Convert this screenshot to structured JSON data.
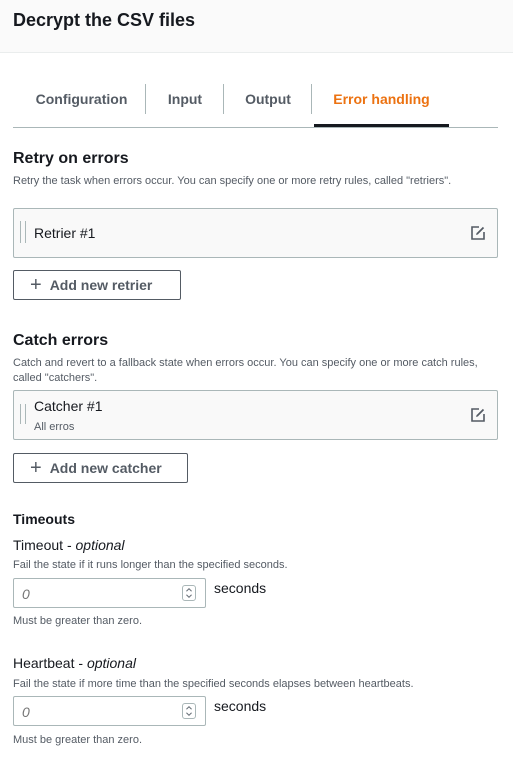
{
  "panel": {
    "title": "Decrypt the CSV files"
  },
  "tabs": [
    {
      "label": "Configuration",
      "active": false
    },
    {
      "label": "Input",
      "active": false
    },
    {
      "label": "Output",
      "active": false
    },
    {
      "label": "Error handling",
      "active": true
    }
  ],
  "retry": {
    "title": "Retry on errors",
    "description": "Retry the task when errors occur. You can specify one or more retry rules, called \"retriers\".",
    "items": [
      {
        "label": "Retrier #1"
      }
    ],
    "add_button": "Add new retrier"
  },
  "catch": {
    "title": "Catch errors",
    "description": "Catch and revert to a fallback state when errors occur. You can specify one or more catch rules, called \"catchers\".",
    "items": [
      {
        "label": "Catcher #1",
        "subtitle": "All erros"
      }
    ],
    "add_button": "Add new catcher"
  },
  "timeouts": {
    "title": "Timeouts",
    "timeout": {
      "label": "Timeout - ",
      "optional": "optional",
      "description": "Fail the state if it runs longer than the specified seconds.",
      "placeholder": "0",
      "unit": "seconds",
      "hint": "Must be greater than zero."
    },
    "heartbeat": {
      "label": "Heartbeat - ",
      "optional": "optional",
      "description": "Fail the state if more time than the specified seconds elapses between heartbeats.",
      "placeholder": "0",
      "unit": "seconds",
      "hint": "Must be greater than zero."
    }
  },
  "colors": {
    "accent": "#ec7211",
    "text": "#16191f",
    "muted": "#545b64",
    "border": "#aab7b8"
  },
  "icons": {
    "edit": "edit-icon",
    "add": "plus-icon",
    "drag": "drag-handle-icon",
    "spinner": "spinner-arrows-icon"
  }
}
